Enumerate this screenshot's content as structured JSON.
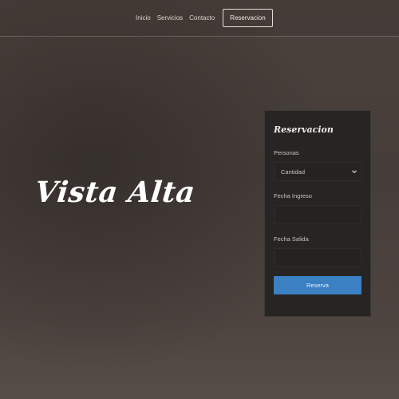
{
  "nav": {
    "links": [
      "Inicio",
      "Servicios",
      "Contacto"
    ],
    "cta_label": "Reservacion"
  },
  "hero": {
    "title": "Vista Alta"
  },
  "reservation_form": {
    "title": "Reservacion",
    "persons_label": "Personas",
    "persons_selected": "Cantidad",
    "checkin_label": "Fecha Ingreso",
    "checkin_value": "",
    "checkout_label": "Fecha Salida",
    "checkout_value": "",
    "submit_label": "Reserva"
  },
  "colors": {
    "accent": "#3a80c3",
    "panel_bg": "#272524",
    "background": "#4a413c"
  }
}
